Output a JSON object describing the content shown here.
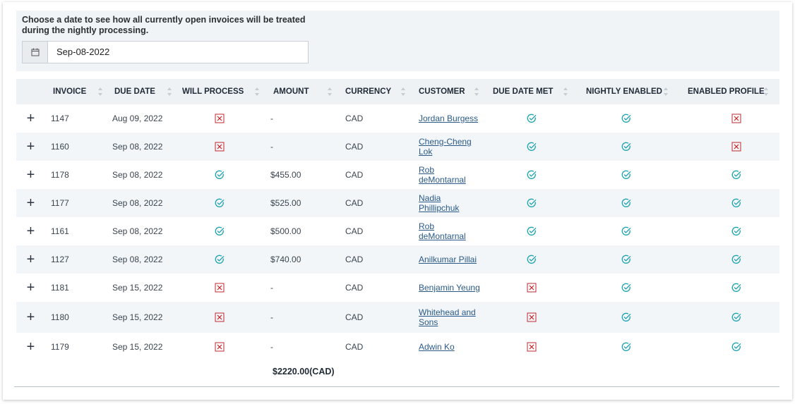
{
  "panel": {
    "prompt": "Choose a date to see how all currently open invoices will be treated during the nightly processing.",
    "date_value": "Sep-08-2022"
  },
  "colors": {
    "check": "#19a3b0",
    "cross": "#c0282f",
    "link": "#2a5a8a"
  },
  "table": {
    "headers": {
      "invoice": "INVOICE",
      "due_date": "DUE DATE",
      "will_process": "WILL PROCESS",
      "amount": "AMOUNT",
      "currency": "CURRENCY",
      "customer": "CUSTOMER",
      "due_date_met": "DUE DATE MET",
      "nightly_enabled": "NIGHTLY ENABLED",
      "enabled_profile": "ENABLED PROFILE"
    },
    "expand_symbol": "+",
    "rows": [
      {
        "invoice": "1147",
        "due_date": "Aug 09, 2022",
        "will_process": "cross",
        "amount": "-",
        "currency": "CAD",
        "customer": "Jordan Burgess",
        "due_date_met": "check",
        "nightly_enabled": "check",
        "enabled_profile": "cross"
      },
      {
        "invoice": "1160",
        "due_date": "Sep 08, 2022",
        "will_process": "cross",
        "amount": "-",
        "currency": "CAD",
        "customer": "Cheng-Cheng Lok",
        "due_date_met": "check",
        "nightly_enabled": "check",
        "enabled_profile": "cross"
      },
      {
        "invoice": "1178",
        "due_date": "Sep 08, 2022",
        "will_process": "check",
        "amount": "$455.00",
        "currency": "CAD",
        "customer": "Rob deMontarnal",
        "due_date_met": "check",
        "nightly_enabled": "check",
        "enabled_profile": "check"
      },
      {
        "invoice": "1177",
        "due_date": "Sep 08, 2022",
        "will_process": "check",
        "amount": "$525.00",
        "currency": "CAD",
        "customer": "Nadia Phillipchuk",
        "due_date_met": "check",
        "nightly_enabled": "check",
        "enabled_profile": "check"
      },
      {
        "invoice": "1161",
        "due_date": "Sep 08, 2022",
        "will_process": "check",
        "amount": "$500.00",
        "currency": "CAD",
        "customer": "Rob deMontarnal",
        "due_date_met": "check",
        "nightly_enabled": "check",
        "enabled_profile": "check"
      },
      {
        "invoice": "1127",
        "due_date": "Sep 08, 2022",
        "will_process": "check",
        "amount": "$740.00",
        "currency": "CAD",
        "customer": "Anilkumar Pillai",
        "due_date_met": "check",
        "nightly_enabled": "check",
        "enabled_profile": "check"
      },
      {
        "invoice": "1181",
        "due_date": "Sep 15, 2022",
        "will_process": "cross",
        "amount": "-",
        "currency": "CAD",
        "customer": "Benjamin Yeung",
        "due_date_met": "cross",
        "nightly_enabled": "check",
        "enabled_profile": "check"
      },
      {
        "invoice": "1180",
        "due_date": "Sep 15, 2022",
        "will_process": "cross",
        "amount": "-",
        "currency": "CAD",
        "customer": "Whitehead and Sons",
        "due_date_met": "cross",
        "nightly_enabled": "check",
        "enabled_profile": "check"
      },
      {
        "invoice": "1179",
        "due_date": "Sep 15, 2022",
        "will_process": "cross",
        "amount": "-",
        "currency": "CAD",
        "customer": "Adwin Ko",
        "due_date_met": "cross",
        "nightly_enabled": "check",
        "enabled_profile": "check"
      }
    ],
    "total": "$2220.00(CAD)"
  }
}
